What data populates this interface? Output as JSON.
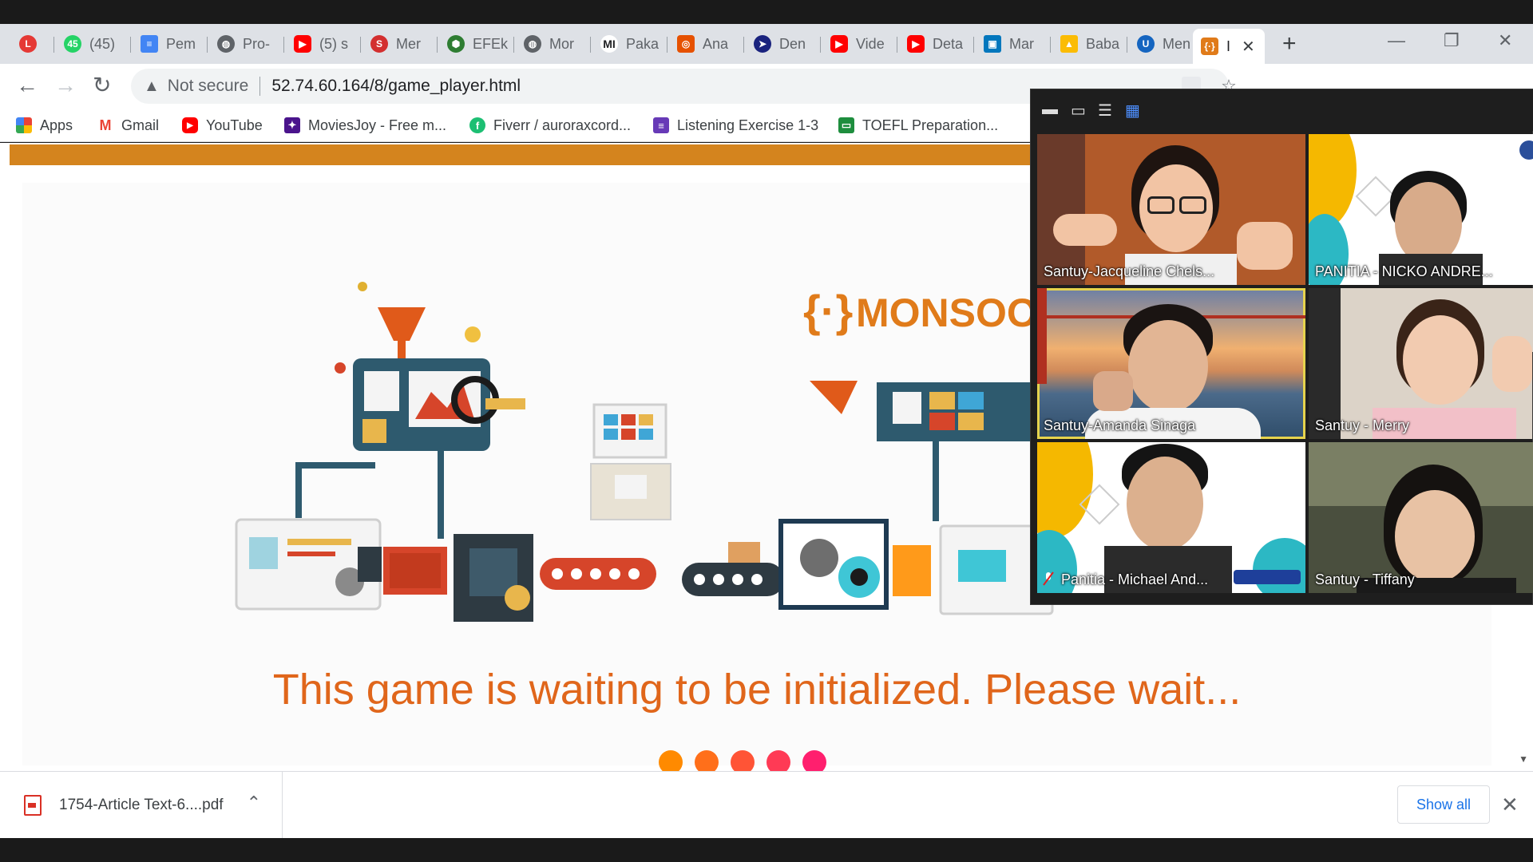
{
  "tabs": [
    {
      "label": "",
      "icon": "l-letter-icon",
      "color": "#e53935"
    },
    {
      "label": "(45)",
      "icon": "whatsapp-icon",
      "color": "#25d366"
    },
    {
      "label": "Pem",
      "icon": "docs-icon",
      "color": "#4285f4"
    },
    {
      "label": "Pro-",
      "icon": "globe-icon",
      "color": "#5f6368"
    },
    {
      "label": "(5) s",
      "icon": "youtube-icon",
      "color": "#ff0000"
    },
    {
      "label": "Mer",
      "icon": "s-letter-icon",
      "color": "#d32f2f"
    },
    {
      "label": "EFEk",
      "icon": "shield-icon",
      "color": "#2e7d32"
    },
    {
      "label": "Mor",
      "icon": "globe-icon",
      "color": "#5f6368"
    },
    {
      "label": "Paka",
      "icon": "mi-logo-icon",
      "color": "#202124"
    },
    {
      "label": "Ana",
      "icon": "app-icon",
      "color": "#e65100"
    },
    {
      "label": "Den",
      "icon": "arrow-logo-icon",
      "color": "#1a237e"
    },
    {
      "label": "Vide",
      "icon": "youtube-icon",
      "color": "#ff0000"
    },
    {
      "label": "Deta",
      "icon": "youtube-icon",
      "color": "#ff0000"
    },
    {
      "label": "Mar",
      "icon": "screen-icon",
      "color": "#0277bd"
    },
    {
      "label": "Baba",
      "icon": "drive-icon",
      "color": "#fbbc04"
    },
    {
      "label": "Men",
      "icon": "u-logo-icon",
      "color": "#1565c0"
    },
    {
      "label": "I",
      "icon": "monsoon-icon",
      "color": "#e07b1a",
      "active": true
    }
  ],
  "address": {
    "security": "Not secure",
    "url": "52.74.60.164/8/game_player.html"
  },
  "bookmarks": [
    {
      "label": "Apps",
      "icon": "apps-grid-icon"
    },
    {
      "label": "Gmail",
      "icon": "gmail-icon"
    },
    {
      "label": "YouTube",
      "icon": "youtube-icon"
    },
    {
      "label": "MoviesJoy - Free m...",
      "icon": "moviesjoy-icon"
    },
    {
      "label": "Fiverr / auroraxcord...",
      "icon": "fiverr-icon"
    },
    {
      "label": "Listening Exercise 1-3",
      "icon": "forms-icon"
    },
    {
      "label": "TOEFL Preparation...",
      "icon": "classroom-icon"
    }
  ],
  "game": {
    "brand": "MONSOO",
    "message": "This game is waiting to be initialized. Please wait...",
    "dot_colors": [
      "#ff8a00",
      "#ff6f1a",
      "#ff5436",
      "#ff3a55",
      "#ff1f6e"
    ]
  },
  "download": {
    "file": "1754-Article Text-6....pdf",
    "show_all": "Show all"
  },
  "zoom": {
    "participants": [
      {
        "name": "Santuy-Jacqueline Chels...",
        "speaking": false,
        "muted": false
      },
      {
        "name": "PANITIA - NICKO ANDRE...",
        "speaking": false,
        "muted": false
      },
      {
        "name": "Santuy-Amanda Sinaga",
        "speaking": true,
        "muted": false
      },
      {
        "name": "Santuy - Merry",
        "speaking": false,
        "muted": false
      },
      {
        "name": "Panitia - Michael And...",
        "speaking": false,
        "muted": true
      },
      {
        "name": "Santuy - Tiffany",
        "speaking": false,
        "muted": false
      }
    ]
  }
}
